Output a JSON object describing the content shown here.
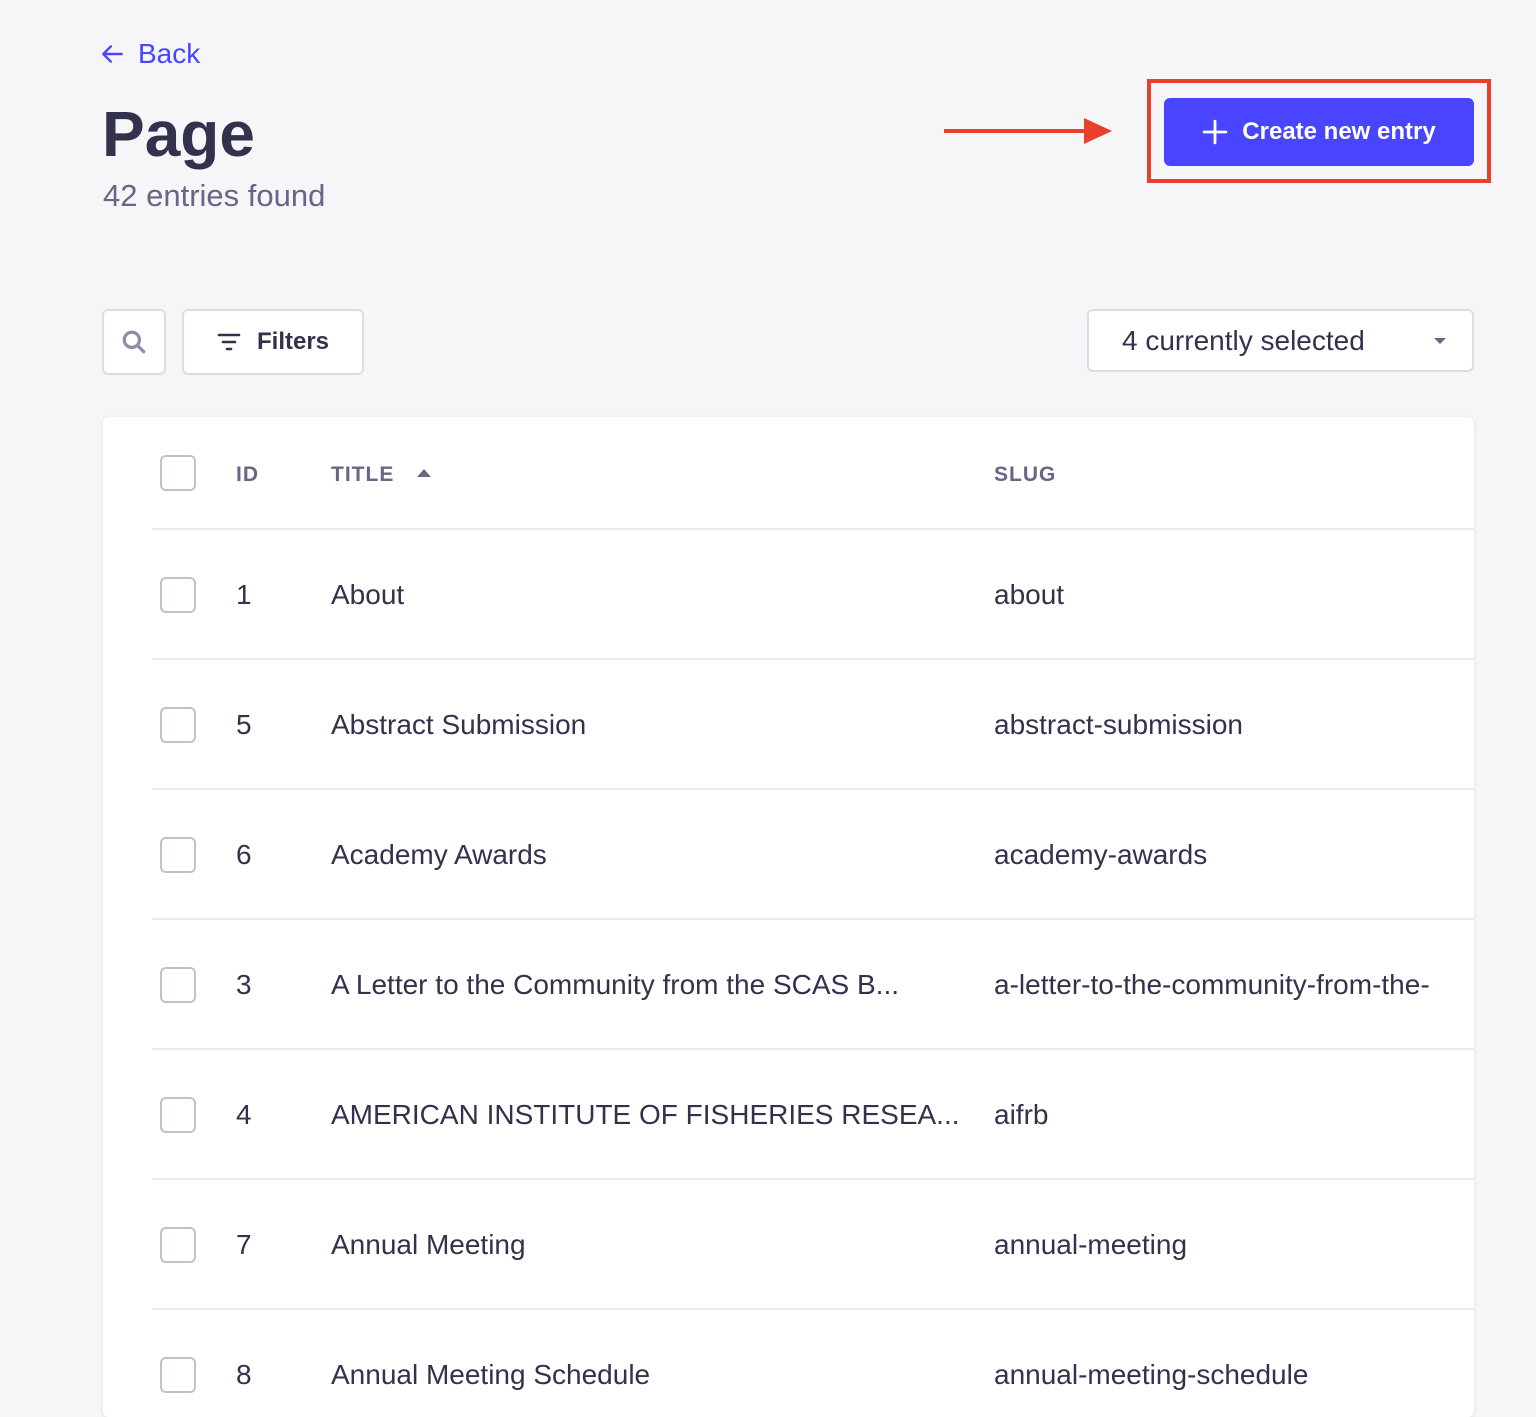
{
  "header": {
    "back_label": "Back",
    "title": "Page",
    "subtitle": "42 entries found",
    "create_label": "Create new entry"
  },
  "toolbar": {
    "search_icon": "search-icon",
    "filters_label": "Filters",
    "columns_selected": "4 currently selected"
  },
  "colors": {
    "primary": "#4945ff",
    "annotation": "#e8402b"
  },
  "table": {
    "columns": [
      "ID",
      "TITLE",
      "SLUG"
    ],
    "sorted_column": "TITLE",
    "sort_direction": "ascending",
    "rows": [
      {
        "id": "1",
        "title": "About",
        "slug": "about"
      },
      {
        "id": "5",
        "title": "Abstract Submission",
        "slug": "abstract-submission"
      },
      {
        "id": "6",
        "title": "Academy Awards",
        "slug": "academy-awards"
      },
      {
        "id": "3",
        "title": "A Letter to the Community from the SCAS B...",
        "slug": "a-letter-to-the-community-from-the-"
      },
      {
        "id": "4",
        "title": "AMERICAN INSTITUTE OF FISHERIES RESEA...",
        "slug": "aifrb"
      },
      {
        "id": "7",
        "title": "Annual Meeting",
        "slug": "annual-meeting"
      },
      {
        "id": "8",
        "title": "Annual Meeting Schedule",
        "slug": "annual-meeting-schedule"
      }
    ]
  }
}
